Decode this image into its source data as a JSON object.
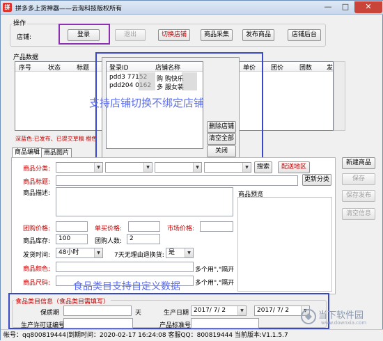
{
  "window": {
    "title": "拼多多上货神器——云淘科技版权所有",
    "minimize": "—",
    "maximize": "□",
    "close": "✕"
  },
  "ops": {
    "group_label": "操作",
    "shop_label": "店铺:",
    "login": "登录",
    "logout": "退出",
    "switch_shop": "切换店铺",
    "product_collect": "商品采集",
    "publish": "发布商品",
    "shop_backend": "店铺后台"
  },
  "product_data": {
    "group_label": "产品数据",
    "columns": [
      "序号",
      "状态",
      "标题",
      "单价",
      "团价",
      "团数",
      "发"
    ],
    "legend": "深蓝色:已发布、已提交草稿  橙色"
  },
  "shop_popup": {
    "columns": [
      "登录ID",
      "店铺名称"
    ],
    "rows": [
      {
        "id": "pdd3    77152",
        "name": "购    购快乐"
      },
      {
        "id": "pdd204    0162",
        "name": "多    服女装"
      }
    ],
    "delete_btn": "删除店铺",
    "clear_btn": "清空全部",
    "close_btn": "关闭",
    "annotation": "支持店铺切换不绑定店铺"
  },
  "edit": {
    "tab_edit": "商品编辑",
    "tab_images": "商品图片",
    "category_label": "商品分类:",
    "search_btn": "搜索",
    "ship_area_btn": "配送地区",
    "title_label": "商品标题:",
    "update_category": "更新分类",
    "desc_label": "商品描述:",
    "preview_label": "商品预览",
    "group_price_label": "团购价格:",
    "single_price_label": "单买价格:",
    "market_price_label": "市场价格:",
    "stock_label": "商品库存:",
    "stock_value": "100",
    "group_count_label": "团购人数:",
    "group_count_value": "2",
    "ship_time_label": "发货时间:",
    "ship_time_value": "48小时",
    "return_label": "7天无理由退换货:",
    "return_value": "是",
    "color_label": "商品颜色:",
    "color_hint": "多个用\",\"隔开",
    "size_label": "商品尺码:",
    "size_hint": "多个用\",\"隔开",
    "annotation": "食品类目支持自定义数据"
  },
  "right_buttons": {
    "new": "新建商品",
    "save": "保存",
    "save_publish": "保存发布",
    "clear_info": "清空信息"
  },
  "food": {
    "group_label": "食品类目信息（食品类目需填写）",
    "shelf_label": "保质期",
    "shelf_unit": "天",
    "prod_date_label": "生产日期",
    "date_from": "2017/ 7/ 2",
    "date_to": "2017/ 7/ 2",
    "license_label": "生产许可证编号",
    "standard_label": "产品标准号"
  },
  "status": {
    "text": "帐号：qq800819444|到期时间：2020-02-17 16:24:08  客服QQ：800819444 当前版本:V1.1.5.7"
  },
  "watermark": {
    "main": "当下软件园",
    "sub": "www.downxia.com"
  },
  "colors": {
    "annotation": "#5a6cf2",
    "highlight_box": "#3748c8",
    "red_label": "#c00000"
  }
}
